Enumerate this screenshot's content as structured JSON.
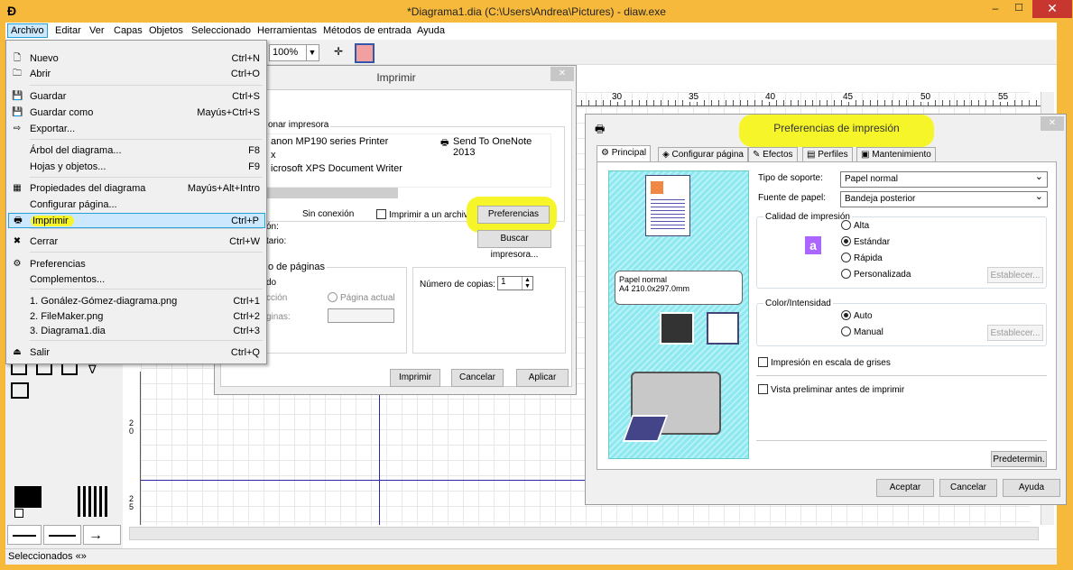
{
  "window": {
    "title": "*Diagrama1.dia (C:\\Users\\Andrea\\Pictures) - diaw.exe"
  },
  "menubar": [
    "Archivo",
    "Editar",
    "Ver",
    "Capas",
    "Objetos",
    "Seleccionado",
    "Herramientas",
    "Métodos de entrada",
    "Ayuda"
  ],
  "toolbar": {
    "zoom": "100%"
  },
  "dropdown": [
    {
      "label": "Nuevo",
      "shortcut": "Ctrl+N",
      "icon": "new-file-icon"
    },
    {
      "label": "Abrir",
      "shortcut": "Ctrl+O",
      "icon": "open-folder-icon"
    },
    {
      "label": "Guardar",
      "shortcut": "Ctrl+S",
      "icon": "save-icon"
    },
    {
      "label": "Guardar como",
      "shortcut": "Mayús+Ctrl+S",
      "icon": "save-as-icon"
    },
    {
      "label": "Exportar...",
      "shortcut": "",
      "icon": "export-icon"
    },
    {
      "label": "Árbol del diagrama...",
      "shortcut": "F8",
      "icon": ""
    },
    {
      "label": "Hojas y objetos...",
      "shortcut": "F9",
      "icon": ""
    },
    {
      "label": "Propiedades del diagrama",
      "shortcut": "Mayús+Alt+Intro",
      "icon": "properties-icon"
    },
    {
      "label": "Configurar página...",
      "shortcut": "",
      "icon": ""
    },
    {
      "label": "Imprimir",
      "shortcut": "Ctrl+P",
      "icon": "print-icon"
    },
    {
      "label": "Cerrar",
      "shortcut": "Ctrl+W",
      "icon": "close-icon"
    },
    {
      "label": "Preferencias",
      "shortcut": "",
      "icon": "preferences-icon"
    },
    {
      "label": "Complementos...",
      "shortcut": "",
      "icon": ""
    },
    {
      "label": "1. Gonález-Gómez-diagrama.png",
      "shortcut": "Ctrl+1",
      "icon": ""
    },
    {
      "label": "2. FileMaker.png",
      "shortcut": "Ctrl+2",
      "icon": ""
    },
    {
      "label": "3. Diagrama1.dia",
      "shortcut": "Ctrl+3",
      "icon": ""
    },
    {
      "label": "Salir",
      "shortcut": "Ctrl+Q",
      "icon": "exit-icon"
    }
  ],
  "print_dialog": {
    "title": "Imprimir",
    "group_printer": "onar impresora",
    "printers": [
      "anon MP190 series Printer",
      "Send To OneNote 2013",
      "x",
      "icrosoft XPS Document Writer"
    ],
    "status_value": "Sin conexión",
    "label_status": "ón:",
    "label_comment": "tario:",
    "print_to_file": "Imprimir a un archivo",
    "preferences_btn": "Preferencias",
    "find_printer_btn": "Buscar impresora...",
    "group_range": "o de páginas",
    "range_all": "do",
    "range_selection": "cción",
    "range_current": "Página actual",
    "range_pages": "ginas:",
    "copies_label": "Número de copias:",
    "copies_value": "1",
    "btn_print": "Imprimir",
    "btn_cancel": "Cancelar",
    "btn_apply": "Aplicar"
  },
  "prefs_dialog": {
    "title": "Preferencias de impresión",
    "tabs": [
      "Principal",
      "Configurar página",
      "Efectos",
      "Perfiles",
      "Mantenimiento"
    ],
    "media_label": "Tipo de soporte:",
    "media_value": "Papel normal",
    "source_label": "Fuente de papel:",
    "source_value": "Bandeja posterior",
    "quality_label": "Calidad de impresión",
    "quality_options": [
      "Alta",
      "Estándar",
      "Rápida",
      "Personalizada"
    ],
    "quality_selected": "Estándar",
    "set_btn": "Establecer...",
    "color_label": "Color/Intensidad",
    "color_options": [
      "Auto",
      "Manual"
    ],
    "color_selected": "Auto",
    "paper_info": [
      "Papel normal",
      "A4 210.0x297.0mm"
    ],
    "grayscale": "Impresión en escala de grises",
    "preview": "Vista preliminar antes de imprimir",
    "defaults_btn": "Predetermin.",
    "ok": "Aceptar",
    "cancel": "Cancelar",
    "help": "Ayuda"
  },
  "ruler": [
    "30",
    "35",
    "40",
    "45",
    "50",
    "55"
  ],
  "ruler_side": [
    "2",
    "0",
    "2",
    "5"
  ],
  "status": "Seleccionados «»",
  "colors": {
    "accent": "#f6b93b",
    "highlight": "#f5f52a",
    "preview_bg": "#8ee8f0"
  }
}
